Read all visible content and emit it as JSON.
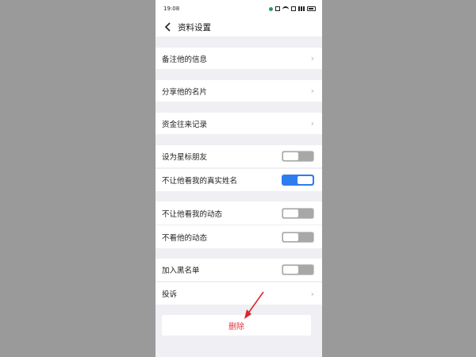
{
  "status_bar": {
    "time": "19:08",
    "icons": [
      "notification-dot-icon",
      "battery-saver-icon",
      "wifi-icon",
      "hd-icon",
      "signal-icon",
      "battery-icon"
    ]
  },
  "header": {
    "back_icon": "chevron-left-icon",
    "title": "资料设置"
  },
  "sections": [
    {
      "items": [
        {
          "label": "备注他的信息",
          "control": "chevron"
        }
      ]
    },
    {
      "items": [
        {
          "label": "分享他的名片",
          "control": "chevron"
        }
      ]
    },
    {
      "items": [
        {
          "label": "资金往来记录",
          "control": "chevron"
        }
      ]
    },
    {
      "items": [
        {
          "label": "设为星标朋友",
          "control": "toggle",
          "on": false
        },
        {
          "label": "不让他看我的真实姓名",
          "control": "toggle",
          "on": true
        }
      ]
    },
    {
      "items": [
        {
          "label": "不让他看我的动态",
          "control": "toggle",
          "on": false
        },
        {
          "label": "不看他的动态",
          "control": "toggle",
          "on": false
        }
      ]
    },
    {
      "items": [
        {
          "label": "加入黑名单",
          "control": "toggle",
          "on": false
        },
        {
          "label": "投诉",
          "control": "chevron"
        }
      ]
    }
  ],
  "delete_button": {
    "label": "删除",
    "color": "#e6333f"
  },
  "colors": {
    "toggle_on": "#2f7bf0",
    "toggle_off": "#a8a8a8",
    "annotation_arrow": "#e0242c"
  }
}
